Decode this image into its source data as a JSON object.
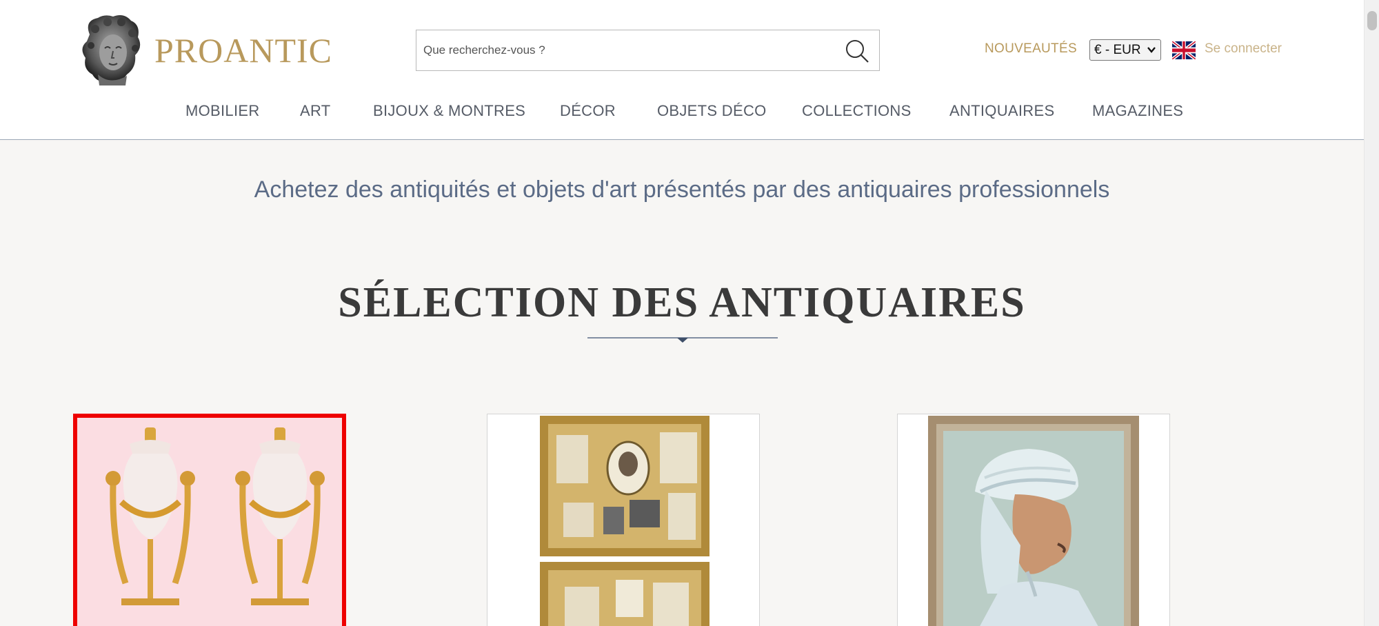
{
  "brand": {
    "name": "PROANTIC"
  },
  "search": {
    "placeholder": "Que recherchez-vous ?"
  },
  "header": {
    "new_label": "NOUVEAUTÉS",
    "currency_selected": "€ - EUR",
    "login_label": "Se connecter"
  },
  "nav": {
    "items": [
      {
        "label": "MOBILIER"
      },
      {
        "label": "ART"
      },
      {
        "label": "BIJOUX & MONTRES"
      },
      {
        "label": "DÉCOR"
      },
      {
        "label": "OBJETS DÉCO"
      },
      {
        "label": "COLLECTIONS"
      },
      {
        "label": "ANTIQUAIRES"
      },
      {
        "label": "MAGAZINES"
      }
    ]
  },
  "tagline": "Achetez des antiquités et objets d'art présentés par des antiquaires professionnels",
  "section": {
    "title": "SÉLECTION DES ANTIQUAIRES"
  },
  "colors": {
    "brand_gold": "#b8995c",
    "nav_text": "#555b66",
    "tagline": "#5b6b86",
    "selection_border": "#ee0000"
  }
}
